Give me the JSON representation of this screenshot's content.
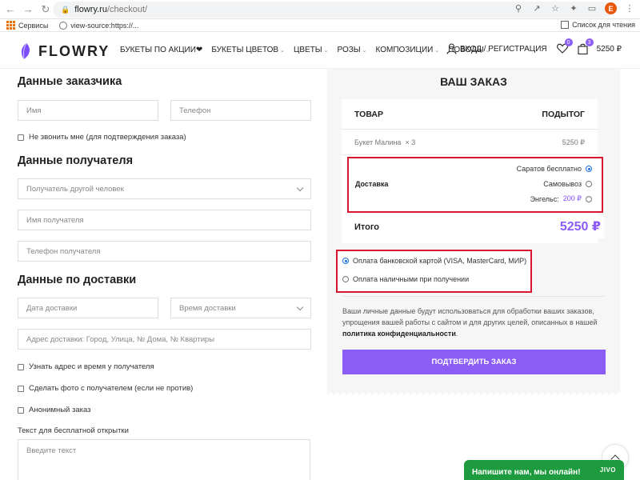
{
  "browser": {
    "url_host": "flowry.ru",
    "url_path": "/checkout/",
    "profile_initial": "E",
    "bookmarks": [
      {
        "label": "Сервисы"
      },
      {
        "label": "view-source:https://..."
      }
    ],
    "reading_list_label": "Список для чтения"
  },
  "header": {
    "logo_text": "FLOWRY",
    "nav": [
      {
        "label": "БУКЕТЫ ПО АКЦИИ❤",
        "has_caret": false
      },
      {
        "label": "БУКЕТЫ ЦВЕТОВ",
        "has_caret": true
      },
      {
        "label": "ЦВЕТЫ",
        "has_caret": true
      },
      {
        "label": "РОЗЫ",
        "has_caret": true
      },
      {
        "label": "КОМПОЗИЦИИ",
        "has_caret": true
      },
      {
        "label": "ПОВОДЫ",
        "has_caret": true
      }
    ],
    "login_label": "ВХОД / РЕГИСТРАЦИЯ",
    "favorites_count": "0",
    "cart_count": "3",
    "cart_total": "5250 ₽"
  },
  "customer": {
    "title": "Данные заказчика",
    "name_placeholder": "Имя",
    "phone_placeholder": "Телефон",
    "no_call_label": "Не звонить мне (для подтверждения заказа)"
  },
  "recipient": {
    "title": "Данные получателя",
    "recipient_select": "Получатель другой человек",
    "name_placeholder": "Имя получателя",
    "phone_placeholder": "Телефон получателя"
  },
  "delivery_info": {
    "title": "Данные по доставки",
    "date_placeholder": "Дата доставки",
    "time_select": "Время доставки",
    "address_placeholder": "Адрес доставки: Город, Улица, № Дома, № Квартиры",
    "options": [
      {
        "label": "Узнать адрес и время у получателя"
      },
      {
        "label": "Сделать фото с получателем (если не против)"
      },
      {
        "label": "Анонимный заказ"
      }
    ],
    "card_text_label": "Текст для бесплатной открытки",
    "card_text_placeholder": "Введите текст"
  },
  "order": {
    "title": "ВАШ ЗАКАЗ",
    "col_product": "ТОВАР",
    "col_subtotal": "ПОДЫТОГ",
    "item_name": "Букет Малина",
    "item_qty": "× 3",
    "item_price": "5250 ₽",
    "shipping_label": "Доставка",
    "shipping_options": [
      {
        "label": "Саратов бесплатно",
        "price": "",
        "selected": true
      },
      {
        "label": "Самовывоз",
        "price": "",
        "selected": false
      },
      {
        "label": "Энгельс:",
        "price": "200 ₽",
        "selected": false
      }
    ],
    "total_label": "Итого",
    "total_value": "5250 ₽",
    "payment_options": [
      {
        "label": "Оплата банковской картой (VISA, MasterCard, МИР)",
        "selected": true
      },
      {
        "label": "Оплата наличными при получении",
        "selected": false
      }
    ],
    "privacy_text": "Ваши личные данные будут использоваться для обработки ваших заказов, упрощения вашей работы с сайтом и для других целей, описанных в нашей",
    "privacy_link": "политика конфиденциальности",
    "privacy_end": ".",
    "confirm_label": "ПОДТВЕРДИТЬ ЗАКАЗ"
  },
  "chat": {
    "label": "Напишите нам, мы онлайн!",
    "brand": "JIVO"
  },
  "colors": {
    "accent": "#8b5cf6",
    "highlight_border": "#d7172f",
    "chat_bg": "#1e9b3e"
  }
}
